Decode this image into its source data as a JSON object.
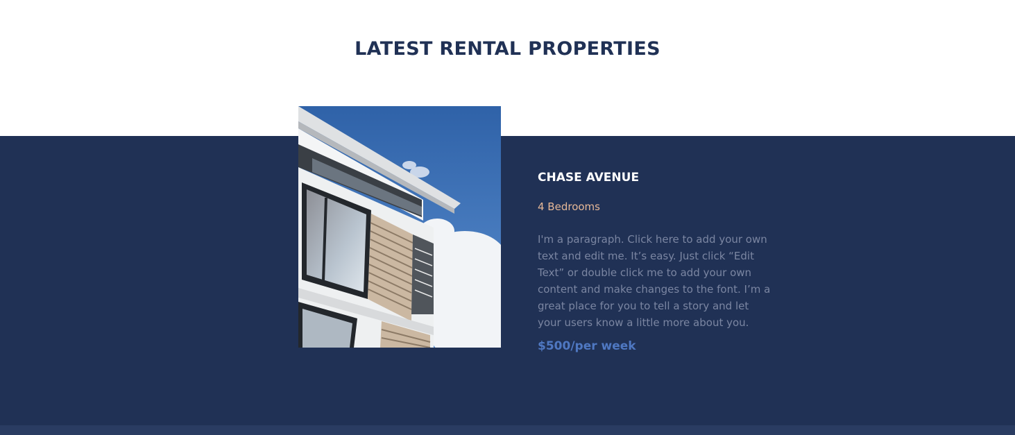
{
  "section": {
    "title": "LATEST RENTAL PROPERTIES"
  },
  "property": {
    "name": "CHASE AVENUE",
    "bedrooms": "4 Bedrooms",
    "description": "I'm a paragraph. Click here to add your own text and edit me. It’s easy. Just click “Edit Text” or double click me to add your own content and make changes to the font. I’m a great place for you to tell a story and let your users know a little more about you.",
    "price": "$500/per week",
    "image_subject": "modern-house-facade-photo"
  },
  "colors": {
    "navy_band": "#203155",
    "title_text": "#203155",
    "bedrooms_text": "#e6b897",
    "description_text": "#7b86a2",
    "price_text": "#4f78c2"
  }
}
